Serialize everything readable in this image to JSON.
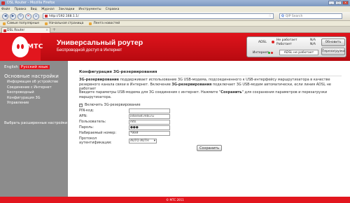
{
  "window": {
    "title": "DSL Router - Mozilla Firefox",
    "controls": [
      "_",
      "□",
      "×"
    ]
  },
  "menu": [
    "Файл",
    "Правка",
    "Вид",
    "Журнал",
    "Закладки",
    "Инструменты",
    "Справка"
  ],
  "nav": {
    "back": "◀",
    "forward": "▶",
    "reload": "↻",
    "stop": "✕",
    "home": "⌂",
    "url": "http://192.168.1.1/",
    "search_placeholder": "QIP Search"
  },
  "bookmarks": [
    "Самые популярные",
    "Начальная страница",
    "Лента новостей"
  ],
  "tab": {
    "label": "DSL Router",
    "close": "×",
    "new": "+"
  },
  "header": {
    "logo": "МТС",
    "title": "Универсальный роутер",
    "subtitle": "Беспроводной доступ в Интернет"
  },
  "status": {
    "adsl_label": "ADSL",
    "val1": "Не работает",
    "val2": "Работает",
    "na1": "N/A",
    "na2": "N/A",
    "refresh": "Обновить",
    "reboot": "Перезагрузка",
    "internet_label": "Интернет",
    "adsl_state": "ADSL не работает"
  },
  "sidebar": {
    "lang_en": "English",
    "lang_ru": "Русский язык",
    "heading": "Основные настройки",
    "items": [
      "Информация об устройстве",
      "Соединение с Интернет",
      "Беспроводный",
      "Конфигурация 3G",
      "Управление"
    ],
    "advanced": "Выбрать расширенные настройки"
  },
  "content": {
    "title": "Конфигурация 3G-резервирования",
    "desc_bold1": "3G-резервирование",
    "desc_part1": " поддерживает использование 3G USB-модема, подсоединенного к USB-интерфейсу маршрутизатора в качестве резервного канала связи в Интернет. Включение ",
    "desc_bold2": "3G-резервирования",
    "desc_part2": " подключает 3G USB-модем автоматически, если линия ADSL не работает",
    "desc2_part1": "Введите параметры USB-модема для 3G соединения с интернет. Нажмите \"",
    "desc2_bold": "Сохранить",
    "desc2_part2": "\" для сохранения параметров и перезагрузки маршрутизатора.",
    "checkbox_label": "Включить 3G-резервирование",
    "checkbox_mark": "✓",
    "fields": [
      {
        "label": "PIN-код:",
        "value": ""
      },
      {
        "label": "APN:",
        "value": "internet.mts.ru"
      },
      {
        "label": "Пользователь:",
        "value": "mts"
      },
      {
        "label": "Пароль:",
        "value": "●●●"
      },
      {
        "label": "Набираемый номер:",
        "value": "*99#"
      }
    ],
    "auth_label": "Протокол аутентификации:",
    "auth_value": "AUTO AUTH",
    "save": "Сохранить"
  },
  "footer": "© МТС 2011"
}
